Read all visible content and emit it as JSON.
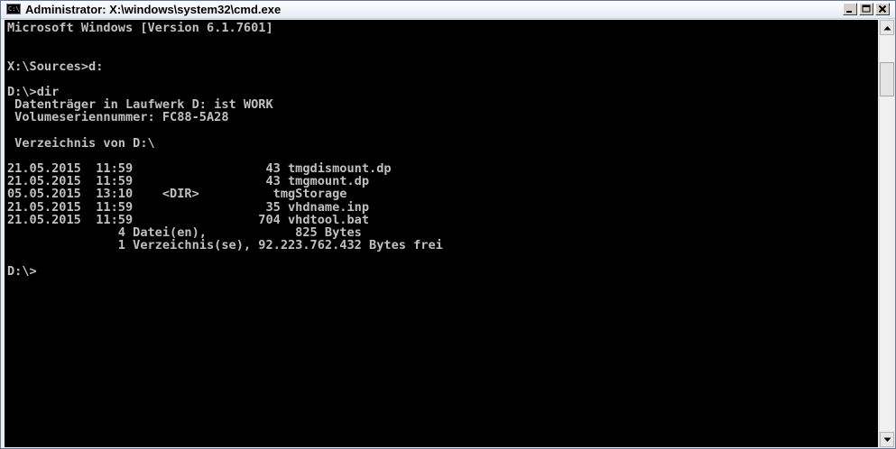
{
  "window": {
    "title": "Administrator: X:\\windows\\system32\\cmd.exe",
    "icon_label": "C:\\"
  },
  "caption_buttons": {
    "minimize": "minimize-icon",
    "maximize": "maximize-icon",
    "close": "close-icon"
  },
  "console": {
    "background": "#000000",
    "foreground": "#c0c0c0",
    "lines": [
      "Microsoft Windows [Version 6.1.7601]",
      "",
      "",
      "X:\\Sources>d:",
      "",
      "D:\\>dir",
      " Datenträger in Laufwerk D: ist WORK",
      " Volumeseriennummer: FC88-5A28",
      "",
      " Verzeichnis von D:\\",
      "",
      "21.05.2015  11:59                  43 tmgdismount.dp",
      "21.05.2015  11:59                  43 tmgmount.dp",
      "05.05.2015  13:10    <DIR>          tmgStorage",
      "21.05.2015  11:59                  35 vhdname.inp",
      "21.05.2015  11:59                 704 vhdtool.bat",
      "               4 Datei(en),            825 Bytes",
      "               1 Verzeichnis(se), 92.223.762.432 Bytes frei",
      "",
      "D:\\>"
    ]
  },
  "scrollbar": {
    "up_icon": "arrow-up-icon",
    "down_icon": "arrow-down-icon"
  }
}
